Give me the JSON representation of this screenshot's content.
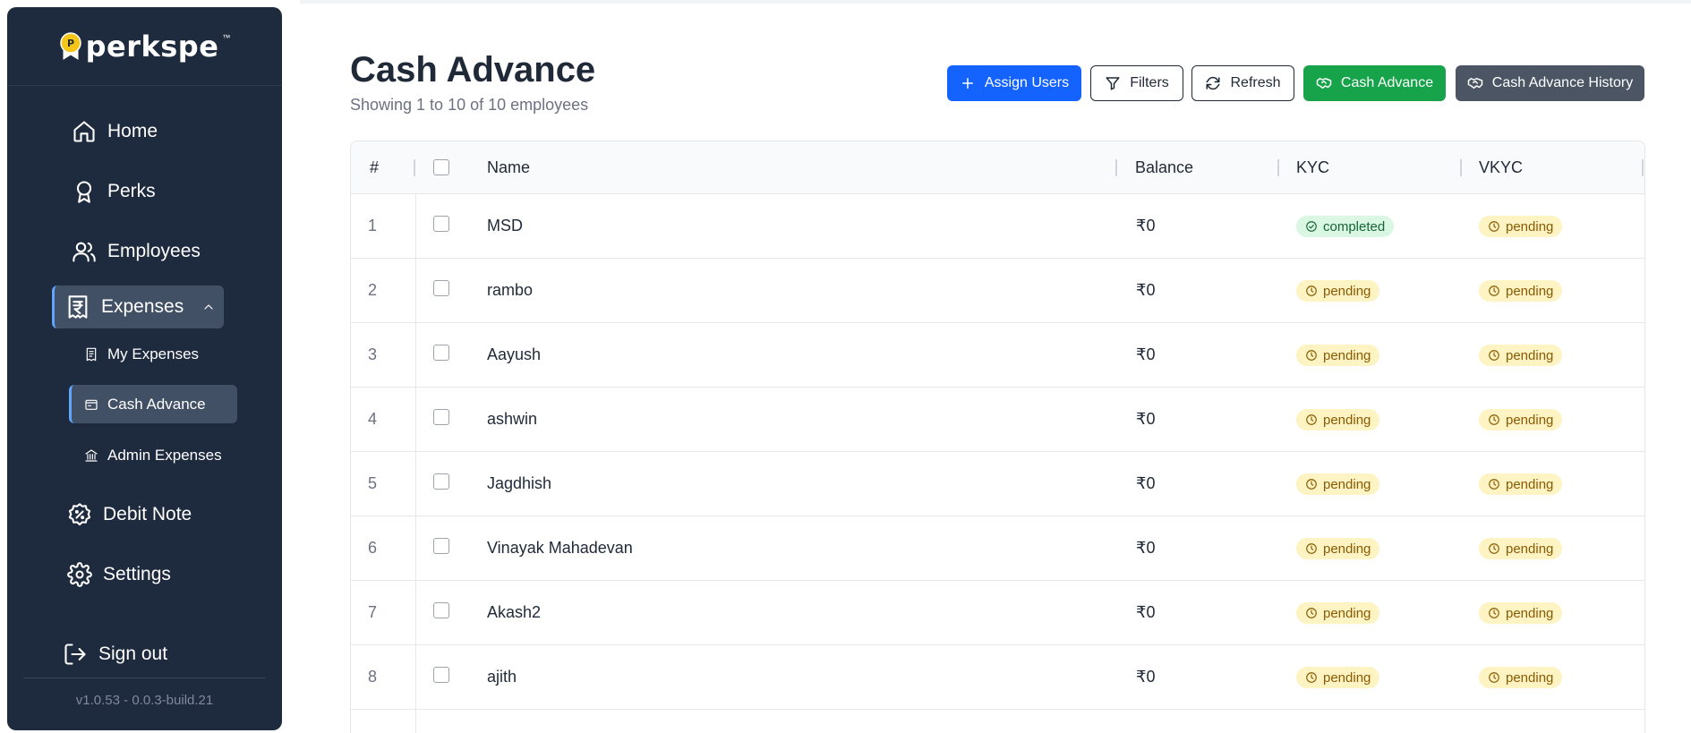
{
  "sidebar": {
    "logo_text": "perkspe",
    "logo_badge_letter": "P",
    "nav": {
      "home": "Home",
      "perks": "Perks",
      "employees": "Employees",
      "expenses": "Expenses",
      "my_expenses": "My Expenses",
      "cash_advance": "Cash Advance",
      "admin_expenses": "Admin Expenses",
      "debit_note": "Debit Note",
      "settings": "Settings",
      "sign_out": "Sign out"
    },
    "version": "v1.0.53 - 0.0.3-build.21"
  },
  "header": {
    "title": "Cash Advance",
    "subtitle": "Showing 1 to 10 of 10 employees"
  },
  "toolbar": {
    "assign_users": "Assign Users",
    "filters": "Filters",
    "refresh": "Refresh",
    "cash_advance": "Cash Advance",
    "cash_advance_history": "Cash Advance History"
  },
  "table": {
    "columns": {
      "index": "#",
      "name": "Name",
      "balance": "Balance",
      "kyc": "KYC",
      "vkyc": "VKYC"
    },
    "rows": [
      {
        "index": "1",
        "name": "MSD",
        "balance": "₹0",
        "kyc": "completed",
        "vkyc": "pending"
      },
      {
        "index": "2",
        "name": "rambo",
        "balance": "₹0",
        "kyc": "pending",
        "vkyc": "pending"
      },
      {
        "index": "3",
        "name": "Aayush",
        "balance": "₹0",
        "kyc": "pending",
        "vkyc": "pending"
      },
      {
        "index": "4",
        "name": "ashwin",
        "balance": "₹0",
        "kyc": "pending",
        "vkyc": "pending"
      },
      {
        "index": "5",
        "name": "Jagdhish",
        "balance": "₹0",
        "kyc": "pending",
        "vkyc": "pending"
      },
      {
        "index": "6",
        "name": "Vinayak Mahadevan",
        "balance": "₹0",
        "kyc": "pending",
        "vkyc": "pending"
      },
      {
        "index": "7",
        "name": "Akash2",
        "balance": "₹0",
        "kyc": "pending",
        "vkyc": "pending"
      },
      {
        "index": "8",
        "name": "ajith",
        "balance": "₹0",
        "kyc": "pending",
        "vkyc": "pending"
      }
    ]
  },
  "colors": {
    "sidebar_bg": "#1e2a3d",
    "sidebar_active": "#425066",
    "primary_blue": "#1463ff",
    "success_green": "#16a34a",
    "neutral_gray": "#4b5563",
    "pending_bg": "#fdf3c3",
    "completed_bg": "#d9f7e3"
  }
}
